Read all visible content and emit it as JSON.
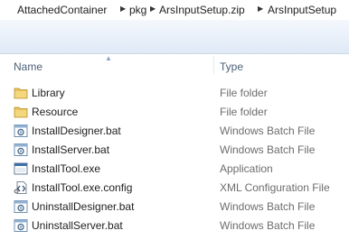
{
  "breadcrumb": [
    "AttachedContainer",
    "pkg",
    "ArsInputSetup.zip",
    "ArsInputSetup"
  ],
  "columns": {
    "name": "Name",
    "type": "Type"
  },
  "files": [
    {
      "name": "Library",
      "type": "File folder",
      "icon": "folder-icon"
    },
    {
      "name": "Resource",
      "type": "File folder",
      "icon": "folder-icon"
    },
    {
      "name": "InstallDesigner.bat",
      "type": "Windows Batch File",
      "icon": "batch-file-icon"
    },
    {
      "name": "InstallServer.bat",
      "type": "Windows Batch File",
      "icon": "batch-file-icon"
    },
    {
      "name": "InstallTool.exe",
      "type": "Application",
      "icon": "application-icon"
    },
    {
      "name": "InstallTool.exe.config",
      "type": "XML Configuration File",
      "icon": "config-file-icon"
    },
    {
      "name": "UninstallDesigner.bat",
      "type": "Windows Batch File",
      "icon": "batch-file-icon"
    },
    {
      "name": "UninstallServer.bat",
      "type": "Windows Batch File",
      "icon": "batch-file-icon"
    }
  ],
  "colors": {
    "header_text": "#4c607a",
    "type_text": "#6d6d6d",
    "folder": "#e8c25a",
    "band": "#dfe9f6"
  }
}
